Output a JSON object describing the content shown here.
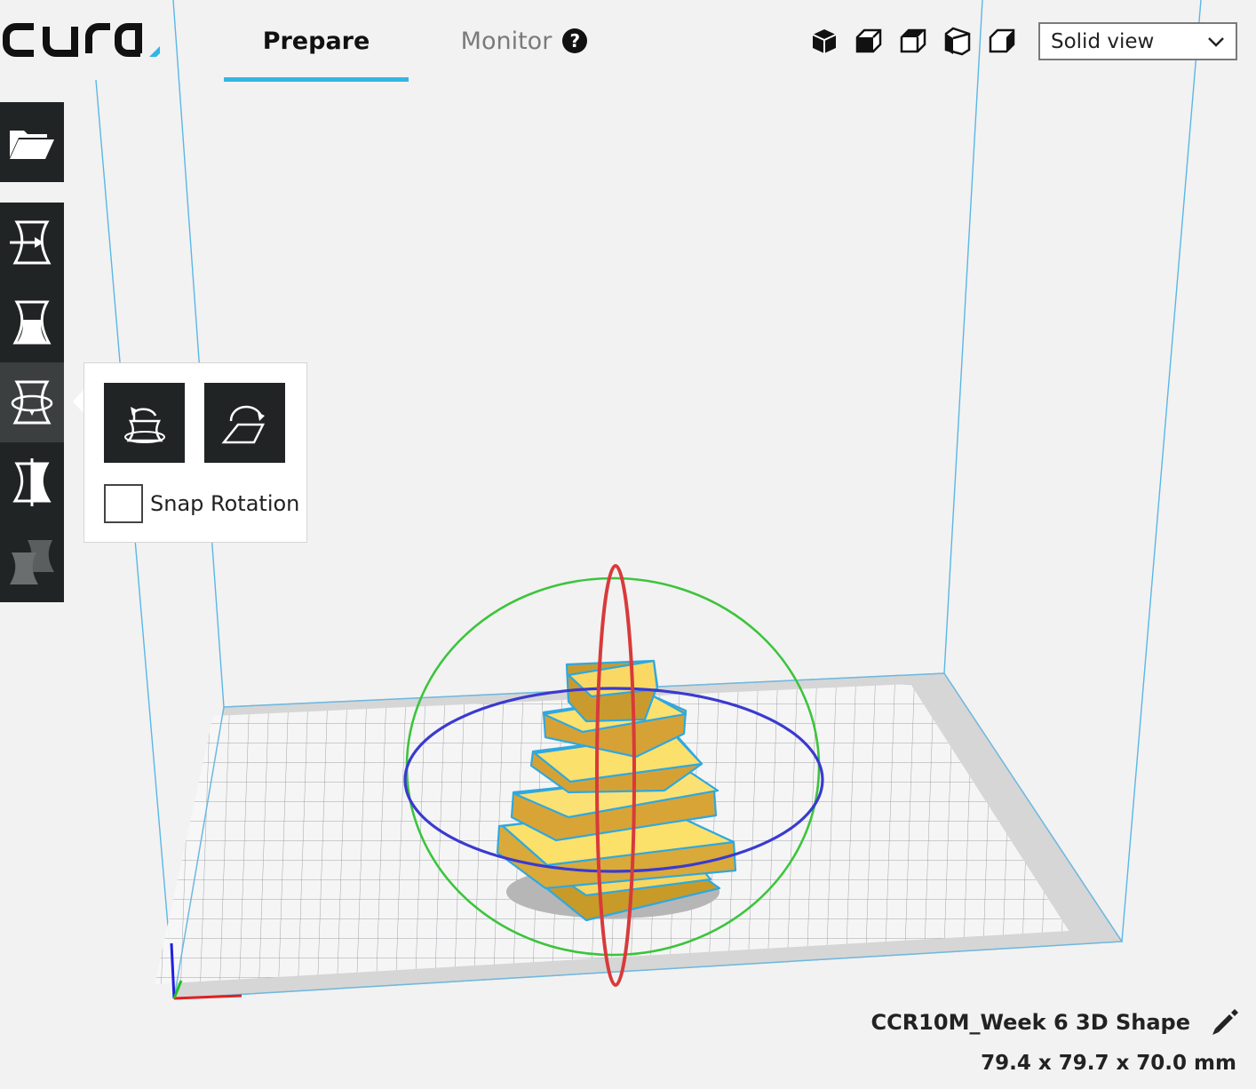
{
  "app": {
    "logo_text": "cura."
  },
  "tabs": [
    {
      "label": "Prepare",
      "active": true
    },
    {
      "label": "Monitor",
      "active": false
    }
  ],
  "view": {
    "icons": [
      "3d-view-icon",
      "front-view-icon",
      "top-view-icon",
      "left-view-icon",
      "right-view-icon"
    ],
    "selected": "Solid view"
  },
  "toolbar": {
    "items": [
      "open-file-icon",
      "move-tool-icon",
      "scale-tool-icon",
      "rotate-tool-icon",
      "mirror-tool-icon",
      "per-model-settings-icon"
    ],
    "active": "rotate-tool-icon"
  },
  "rotate_panel": {
    "buttons": [
      "reset-rotation-icon",
      "lay-flat-icon"
    ],
    "snap_label": "Snap Rotation",
    "snap_checked": false
  },
  "model": {
    "name": "CCR10M_Week 6 3D Shape",
    "dimensions": "79.4 x 79.7 x 70.0 mm"
  },
  "colors": {
    "accent": "#34b5e5",
    "toolbar_bg": "#212424",
    "model_fill": "#f6d25a",
    "rotate_x": "#d83a3a",
    "rotate_y": "#3a3ad0",
    "rotate_z": "#3cc43c"
  }
}
